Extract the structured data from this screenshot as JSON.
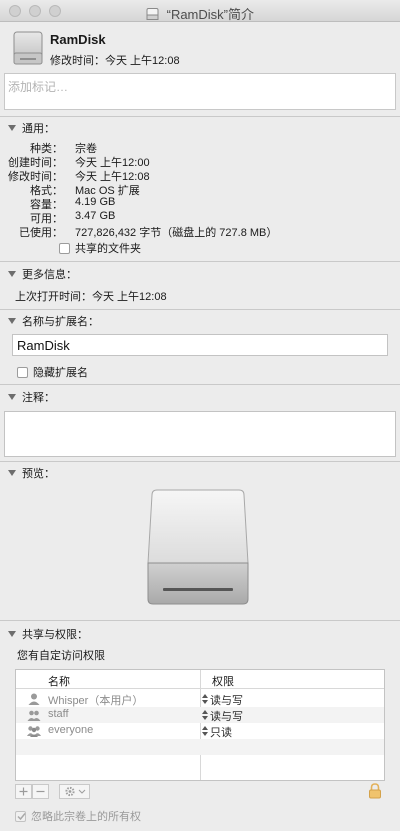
{
  "window": {
    "title": "“RamDisk”简介"
  },
  "header": {
    "name": "RamDisk",
    "modified": "修改时间：今天 上午12:08"
  },
  "tags": {
    "placeholder": "添加标记…"
  },
  "general": {
    "title": "通用：",
    "rows": [
      {
        "key": "种类：",
        "value": "宗卷"
      },
      {
        "key": "创建时间：",
        "value": "今天 上午12:00"
      },
      {
        "key": "修改时间：",
        "value": "今天 上午12:08"
      },
      {
        "key": "格式：",
        "value": "Mac OS 扩展"
      },
      {
        "key": "容量：",
        "value": "4.19 GB"
      },
      {
        "key": "可用：",
        "value": "3.47 GB"
      },
      {
        "key": "已使用：",
        "value": "727,826,432 字节（磁盘上的 727.8 MB）"
      }
    ],
    "shared_folder": "共享的文件夹"
  },
  "more_info": {
    "title": "更多信息：",
    "last_opened": "上次打开时间：今天 上午12:08"
  },
  "name_ext": {
    "title": "名称与扩展名：",
    "value": "RamDisk",
    "hide_ext": "隐藏扩展名"
  },
  "comments": {
    "title": "注释："
  },
  "preview": {
    "title": "预览："
  },
  "sharing": {
    "title": "共享与权限：",
    "access_note": "您有自定访问权限",
    "col_name": "名称",
    "col_priv": "权限",
    "rows": [
      {
        "name": "Whisper（本用户）",
        "privilege": "读与写",
        "icon": "user-icon"
      },
      {
        "name": "staff",
        "privilege": "读与写",
        "icon": "group-icon"
      },
      {
        "name": "everyone",
        "privilege": "只读",
        "icon": "everyone-icon"
      }
    ],
    "ignore_ownership": "忽略此宗卷上的所有权"
  }
}
